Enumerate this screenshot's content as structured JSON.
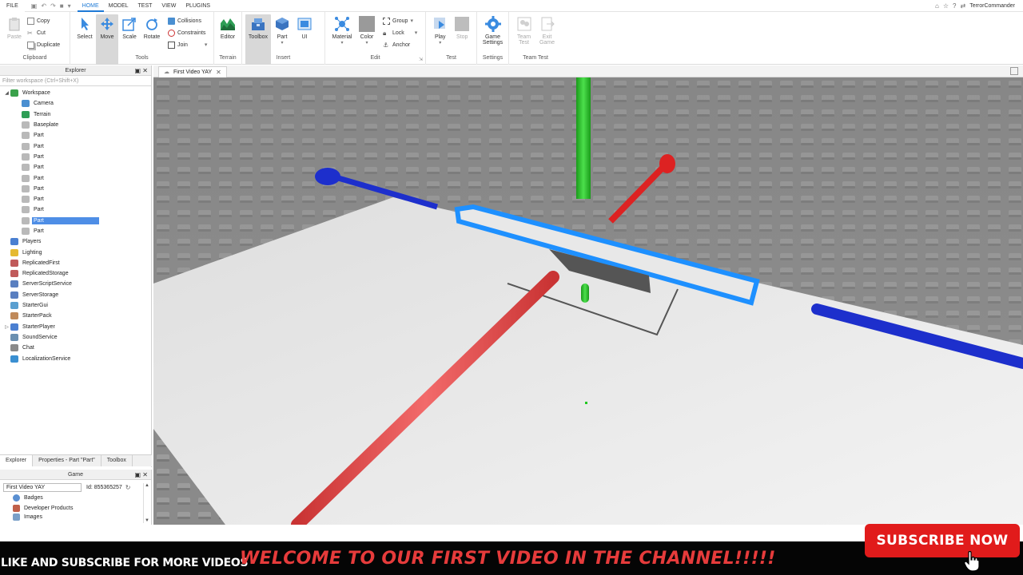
{
  "menu": {
    "tabs": [
      "FILE",
      "HOME",
      "MODEL",
      "TEST",
      "VIEW",
      "PLUGINS"
    ],
    "active_tab": "HOME",
    "username": "TerrorCommander"
  },
  "ribbon": {
    "clipboard": {
      "paste": "Paste",
      "copy": "Copy",
      "cut": "Cut",
      "duplicate": "Duplicate",
      "label": "Clipboard"
    },
    "tools": {
      "select": "Select",
      "move": "Move",
      "scale": "Scale",
      "rotate": "Rotate",
      "collisions": "Collisions",
      "constraints": "Constraints",
      "join": "Join",
      "label": "Tools"
    },
    "terrain": {
      "editor": "Editor",
      "label": "Terrain"
    },
    "insert": {
      "toolbox": "Toolbox",
      "part": "Part",
      "ui": "UI",
      "label": "Insert"
    },
    "edit": {
      "material": "Material",
      "color": "Color",
      "group": "Group",
      "lock": "Lock",
      "anchor": "Anchor",
      "label": "Edit"
    },
    "test": {
      "play": "Play",
      "stop": "Stop",
      "label": "Test"
    },
    "settings": {
      "game_settings_1": "Game",
      "game_settings_2": "Settings",
      "label": "Settings"
    },
    "team_test": {
      "team_test_1": "Team",
      "team_test_2": "Test",
      "exit_game_1": "Exit",
      "exit_game_2": "Game",
      "label": "Team Test"
    }
  },
  "explorer": {
    "title": "Explorer",
    "filter_placeholder": "Filter workspace (Ctrl+Shift+X)",
    "items": [
      {
        "label": "Workspace",
        "level": 0,
        "arrow": "◢",
        "color": "#3aa14b"
      },
      {
        "label": "Camera",
        "level": 1,
        "arrow": "",
        "color": "#4a8fd1"
      },
      {
        "label": "Terrain",
        "level": 1,
        "arrow": "",
        "color": "#2e9e55"
      },
      {
        "label": "Baseplate",
        "level": 1,
        "arrow": "",
        "color": "#b9b9b9"
      },
      {
        "label": "Part",
        "level": 1,
        "arrow": "",
        "color": "#b9b9b9"
      },
      {
        "label": "Part",
        "level": 1,
        "arrow": "",
        "color": "#b9b9b9"
      },
      {
        "label": "Part",
        "level": 1,
        "arrow": "",
        "color": "#b9b9b9"
      },
      {
        "label": "Part",
        "level": 1,
        "arrow": "",
        "color": "#b9b9b9"
      },
      {
        "label": "Part",
        "level": 1,
        "arrow": "",
        "color": "#b9b9b9"
      },
      {
        "label": "Part",
        "level": 1,
        "arrow": "",
        "color": "#b9b9b9"
      },
      {
        "label": "Part",
        "level": 1,
        "arrow": "",
        "color": "#b9b9b9"
      },
      {
        "label": "Part",
        "level": 1,
        "arrow": "",
        "color": "#b9b9b9"
      },
      {
        "label": "Part",
        "level": 1,
        "arrow": "",
        "color": "#b9b9b9",
        "selected": true
      },
      {
        "label": "Part",
        "level": 1,
        "arrow": "",
        "color": "#b9b9b9"
      },
      {
        "label": "Players",
        "level": 0,
        "arrow": "",
        "color": "#4a7fd1"
      },
      {
        "label": "Lighting",
        "level": 0,
        "arrow": "",
        "color": "#e5b931"
      },
      {
        "label": "ReplicatedFirst",
        "level": 0,
        "arrow": "",
        "color": "#c05a5a"
      },
      {
        "label": "ReplicatedStorage",
        "level": 0,
        "arrow": "",
        "color": "#c05a5a"
      },
      {
        "label": "ServerScriptService",
        "level": 0,
        "arrow": "",
        "color": "#5a7fc0"
      },
      {
        "label": "ServerStorage",
        "level": 0,
        "arrow": "",
        "color": "#5a7fc0"
      },
      {
        "label": "StarterGui",
        "level": 0,
        "arrow": "",
        "color": "#5a9fd0"
      },
      {
        "label": "StarterPack",
        "level": 0,
        "arrow": "",
        "color": "#c08a5a"
      },
      {
        "label": "StarterPlayer",
        "level": 0,
        "arrow": "▷",
        "color": "#4a7fd1"
      },
      {
        "label": "SoundService",
        "level": 0,
        "arrow": "",
        "color": "#6a8fb0"
      },
      {
        "label": "Chat",
        "level": 0,
        "arrow": "",
        "color": "#8a8a8a"
      },
      {
        "label": "LocalizationService",
        "level": 0,
        "arrow": "",
        "color": "#3a8fd1"
      }
    ],
    "tabs": [
      "Explorer",
      "Properties - Part \"Part\"",
      "Toolbox"
    ]
  },
  "game_panel": {
    "title": "Game",
    "name_value": "First Video YAY",
    "id_text": "Id: 855365257",
    "items": [
      "Badges",
      "Developer Products",
      "Images"
    ]
  },
  "document": {
    "tab_label": "First Video YAY"
  },
  "banner": {
    "left_text": "LIKE AND SUBSCRIBE FOR MORE VIDEOS",
    "center_text": "WELCOME TO OUR FIRST VIDEO IN THE CHANNEL!!!!!",
    "subscribe_label": "SUBSCRIBE NOW"
  }
}
